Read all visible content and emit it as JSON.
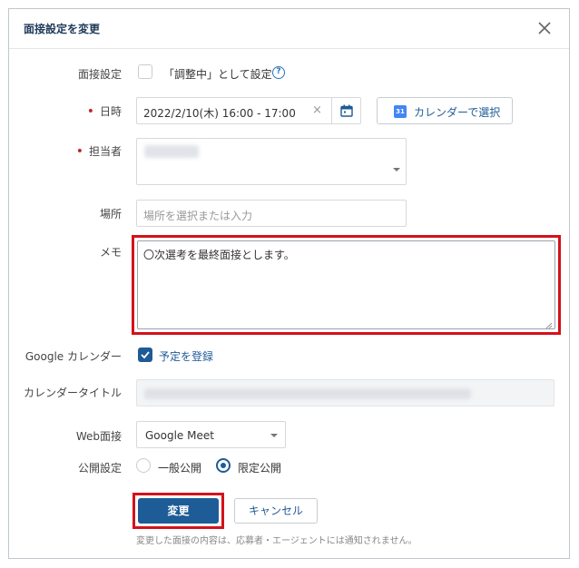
{
  "dialog": {
    "title": "面接設定を変更"
  },
  "interview_setting": {
    "label": "面接設定",
    "checkbox_label": "「調整中」として設定",
    "checked": false
  },
  "datetime": {
    "label": "日時",
    "value": "2022/2/10(木) 16:00 - 17:00",
    "calendar_select_label": "カレンダーで選択",
    "calendar_icon_text": "31"
  },
  "assignee": {
    "label": "担当者"
  },
  "location": {
    "label": "場所",
    "placeholder": "場所を選択または入力"
  },
  "memo": {
    "label": "メモ",
    "value": "〇次選考を最終面接とします。"
  },
  "google_calendar": {
    "label": "Google カレンダー",
    "checkbox_label": "予定を登録",
    "checked": true
  },
  "calendar_title": {
    "label": "カレンダータイトル"
  },
  "web_interview": {
    "label": "Web面接",
    "selected": "Google Meet"
  },
  "visibility": {
    "label": "公開設定",
    "options": [
      "一般公開",
      "限定公開"
    ],
    "selected": "限定公開"
  },
  "actions": {
    "submit_label": "変更",
    "cancel_label": "キャンセル",
    "note": "変更した面接の内容は、応募者・エージェントには通知されません。"
  },
  "colors": {
    "primary": "#1d5c96",
    "required": "#c0282d",
    "highlight": "#d4121a"
  }
}
